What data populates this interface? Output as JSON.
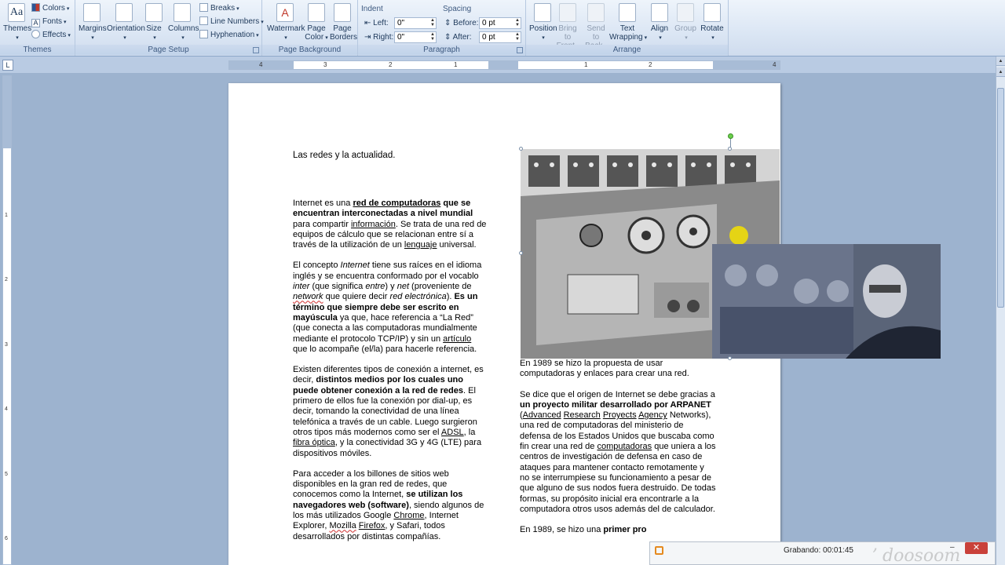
{
  "ribbon": {
    "themes": {
      "themes_label": "Themes",
      "colors": "Colors",
      "fonts": "Fonts",
      "effects": "Effects",
      "group_label": "Themes"
    },
    "page_setup": {
      "margins": "Margins",
      "orientation": "Orientation",
      "size": "Size",
      "columns": "Columns",
      "breaks": "Breaks",
      "line_numbers": "Line Numbers",
      "hyphenation": "Hyphenation",
      "group_label": "Page Setup"
    },
    "page_background": {
      "watermark": "Watermark",
      "page_color_1": "Page",
      "page_color_2": "Color",
      "page_borders_1": "Page",
      "page_borders_2": "Borders",
      "group_label": "Page Background"
    },
    "paragraph": {
      "indent_title": "Indent",
      "left_label": "Left:",
      "left_value": "0\"",
      "right_label": "Right:",
      "right_value": "0\"",
      "spacing_title": "Spacing",
      "before_label": "Before:",
      "before_value": "0 pt",
      "after_label": "After:",
      "after_value": "0 pt",
      "group_label": "Paragraph"
    },
    "arrange": {
      "position": "Position",
      "bring_front_1": "Bring to",
      "bring_front_2": "Front",
      "send_back_1": "Send to",
      "send_back_2": "Back",
      "text_wrap_1": "Text",
      "text_wrap_2": "Wrapping",
      "align": "Align",
      "group": "Group",
      "rotate": "Rotate",
      "group_label": "Arrange"
    }
  },
  "ruler": {
    "tab_selector": "L",
    "h_numbers": [
      "4",
      "3",
      "2",
      "1",
      "1",
      "2",
      "4"
    ],
    "v_numbers": [
      "1",
      "2",
      "3",
      "4",
      "5",
      "6"
    ]
  },
  "document": {
    "title": "Las redes y la actualidad.",
    "left_col": {
      "p1_a": "Internet es una ",
      "p1_b": "red de computadoras",
      "p1_c": " que se encuentran interconectadas a nivel mundial",
      "p1_d": " para compartir ",
      "p1_e": "información",
      "p1_f": ". Se trata de una red de equipos de cálculo que se relacionan entre sí a través de la utilización de un ",
      "p1_g": "lenguaje",
      "p1_h": " universal.",
      "p2_a": "El concepto ",
      "p2_b": "Internet",
      "p2_c": " tiene sus raíces en el idioma inglés y se encuentra conformado por el vocablo ",
      "p2_d": "inter",
      "p2_e": " (que significa ",
      "p2_f": "entre",
      "p2_g": ") y ",
      "p2_h": "net",
      "p2_i": "  (proveniente de ",
      "p2_j": "network",
      "p2_k": " que quiere decir ",
      "p2_l": "red electrónica",
      "p2_m": "). ",
      "p2_n": "Es un término que siempre debe ser escrito en mayúscula",
      "p2_o": " ya que, hace referencia a “La Red” (que conecta a las computadoras mundialmente mediante el protocolo TCP/IP) y sin un ",
      "p2_p": "artículo",
      "p2_q": " que lo acompañe (el/la) para hacerle referencia.",
      "p3_a": "Existen diferentes tipos de conexión a internet, es decir, ",
      "p3_b": "distintos medios por los cuales uno puede obtener conexión a la red de redes",
      "p3_c": ". El primero de ellos fue la conexión por dial-up, es decir, tomando la conectividad de una línea telefónica a través de un cable. Luego surgieron otros tipos más modernos como ser el ",
      "p3_d": "ADSL",
      "p3_e": ", la ",
      "p3_f": "fibra óptica",
      "p3_g": ", y la conectividad 3G y 4G (LTE) para dispositivos móviles.",
      "p4_a": "Para acceder a los billones de sitios web disponibles en la gran red de redes, que conocemos como la Internet, ",
      "p4_b": "se utilizan los navegadores web (software)",
      "p4_c": ", siendo algunos de los más utilizados Google ",
      "p4_d": "Chrome",
      "p4_e": ", Internet Explorer, ",
      "p4_f": "Mozilla",
      "p4_g": " ",
      "p4_h": "Firefox",
      "p4_i": ", y Safari, todos desarrollados por distintas compañías."
    },
    "right_col": {
      "p1": "En 1989 se hizo la propuesta de usar computadoras y enlaces para crear una red.",
      "p2_a": "Se dice que el origen de Internet se debe gracias a ",
      "p2_b": "un proyecto militar desarrollado por ARPANET",
      "p2_c": " (",
      "p2_d": "Advanced",
      "p2_e": " ",
      "p2_f": "Research",
      "p2_g": " ",
      "p2_h": "Proyects",
      "p2_i": " ",
      "p2_j": "Agency",
      "p2_k": " Networks), una red de computadoras del ministerio de defensa de los Estados Unidos que buscaba como fin crear una red de ",
      "p2_l": "computadoras",
      "p2_m": " que uniera a los centros de investigación de defensa en caso de ataques para mantener contacto remotamente y no se interrumpiese su funcionamiento a pesar de que alguno de sus nodos fuera destruido. De todas formas, su propósito inicial era encontrarle a la computadora otros usos además del de calculador.",
      "p3_a": "En 1989, se hizo una ",
      "p3_b": "primer pro"
    }
  },
  "recorder": {
    "label": "Grabando:  00:01:45",
    "min": "–",
    "close": "✕"
  },
  "watermark_text": "ʼ doosoom"
}
